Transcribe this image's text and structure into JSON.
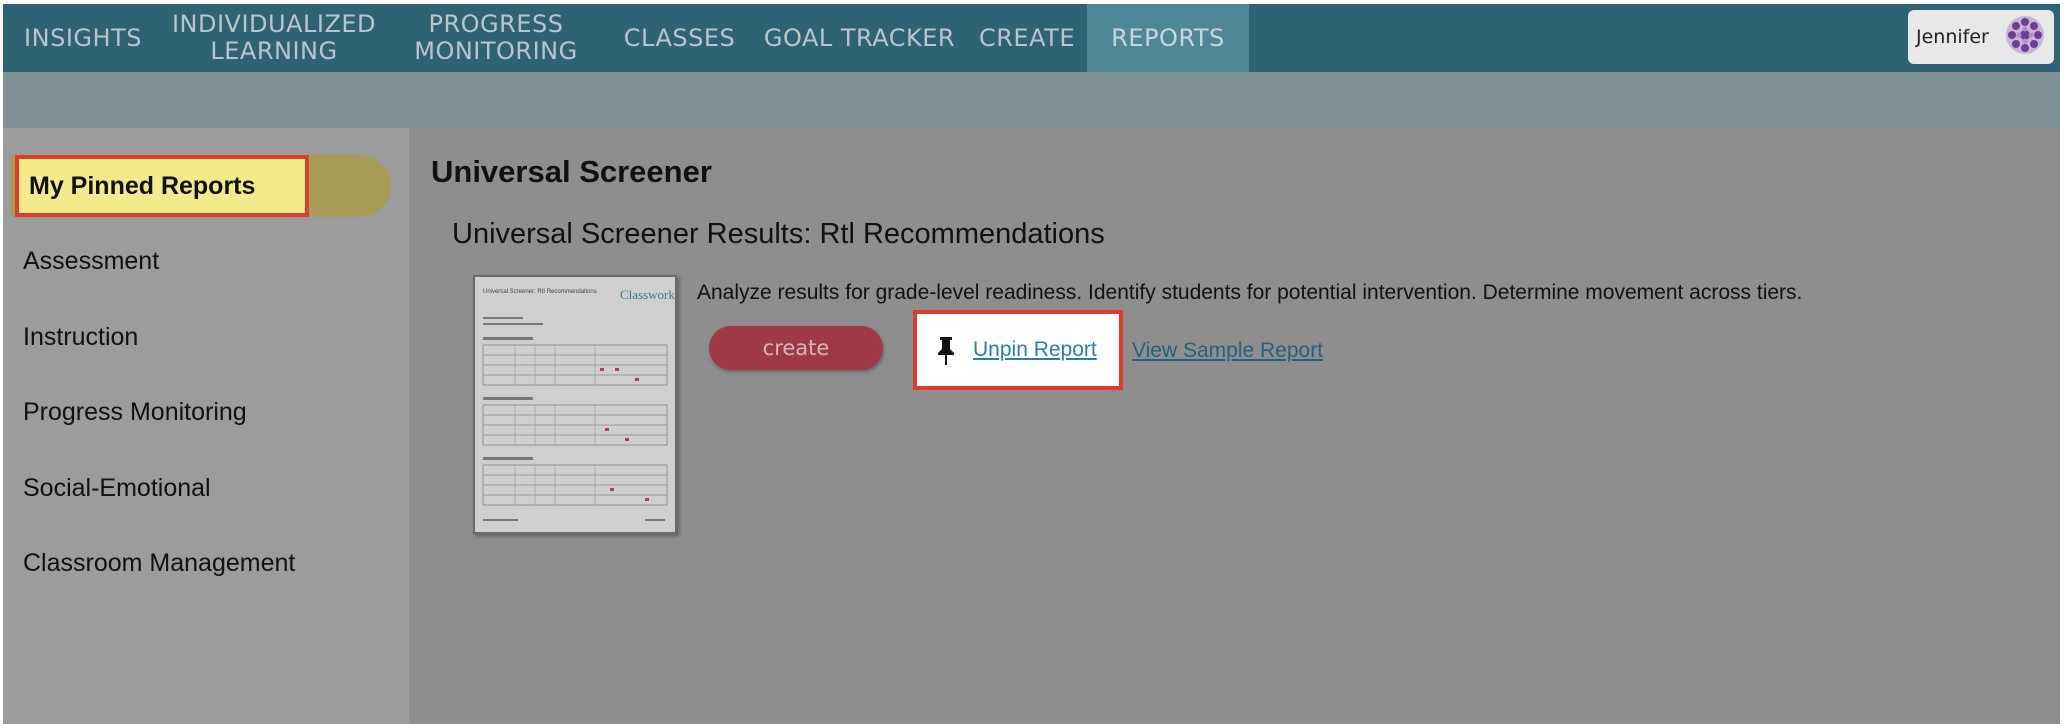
{
  "nav": {
    "items": [
      {
        "label": "INSIGHTS"
      },
      {
        "label": "INDIVIDUALIZED\nLEARNING"
      },
      {
        "label": "PROGRESS\nMONITORING"
      },
      {
        "label": "CLASSES"
      },
      {
        "label": "GOAL TRACKER"
      },
      {
        "label": "CREATE"
      },
      {
        "label": "REPORTS",
        "active": true
      }
    ],
    "user": {
      "name": "Jennifer",
      "avatar_icon": "purple-flower-avatar"
    }
  },
  "sidebar": {
    "items": [
      {
        "label": "My Pinned Reports",
        "selected": true
      },
      {
        "label": "Assessment"
      },
      {
        "label": "Instruction"
      },
      {
        "label": "Progress Monitoring"
      },
      {
        "label": "Social-Emotional"
      },
      {
        "label": "Classroom Management"
      }
    ]
  },
  "main": {
    "title": "Universal Screener",
    "report": {
      "title": "Universal Screener Results: Rtl Recommendations",
      "description": "Analyze results for grade-level readiness. Identify students for potential intervention. Determine movement across tiers.",
      "create_label": "create",
      "unpin_label": "Unpin Report",
      "sample_label": "View Sample Report",
      "thumbnail": {
        "heading": "Universal Screener: RtI Recommendations",
        "brand": "Classworks"
      }
    }
  },
  "colors": {
    "nav_bg": "#2f6272",
    "nav_active": "#4f8797",
    "highlight_border": "#e23a2e",
    "pinned_bg": "#f3ea8b",
    "create_btn": "#9e3a45",
    "link": "#2a7fa8"
  }
}
